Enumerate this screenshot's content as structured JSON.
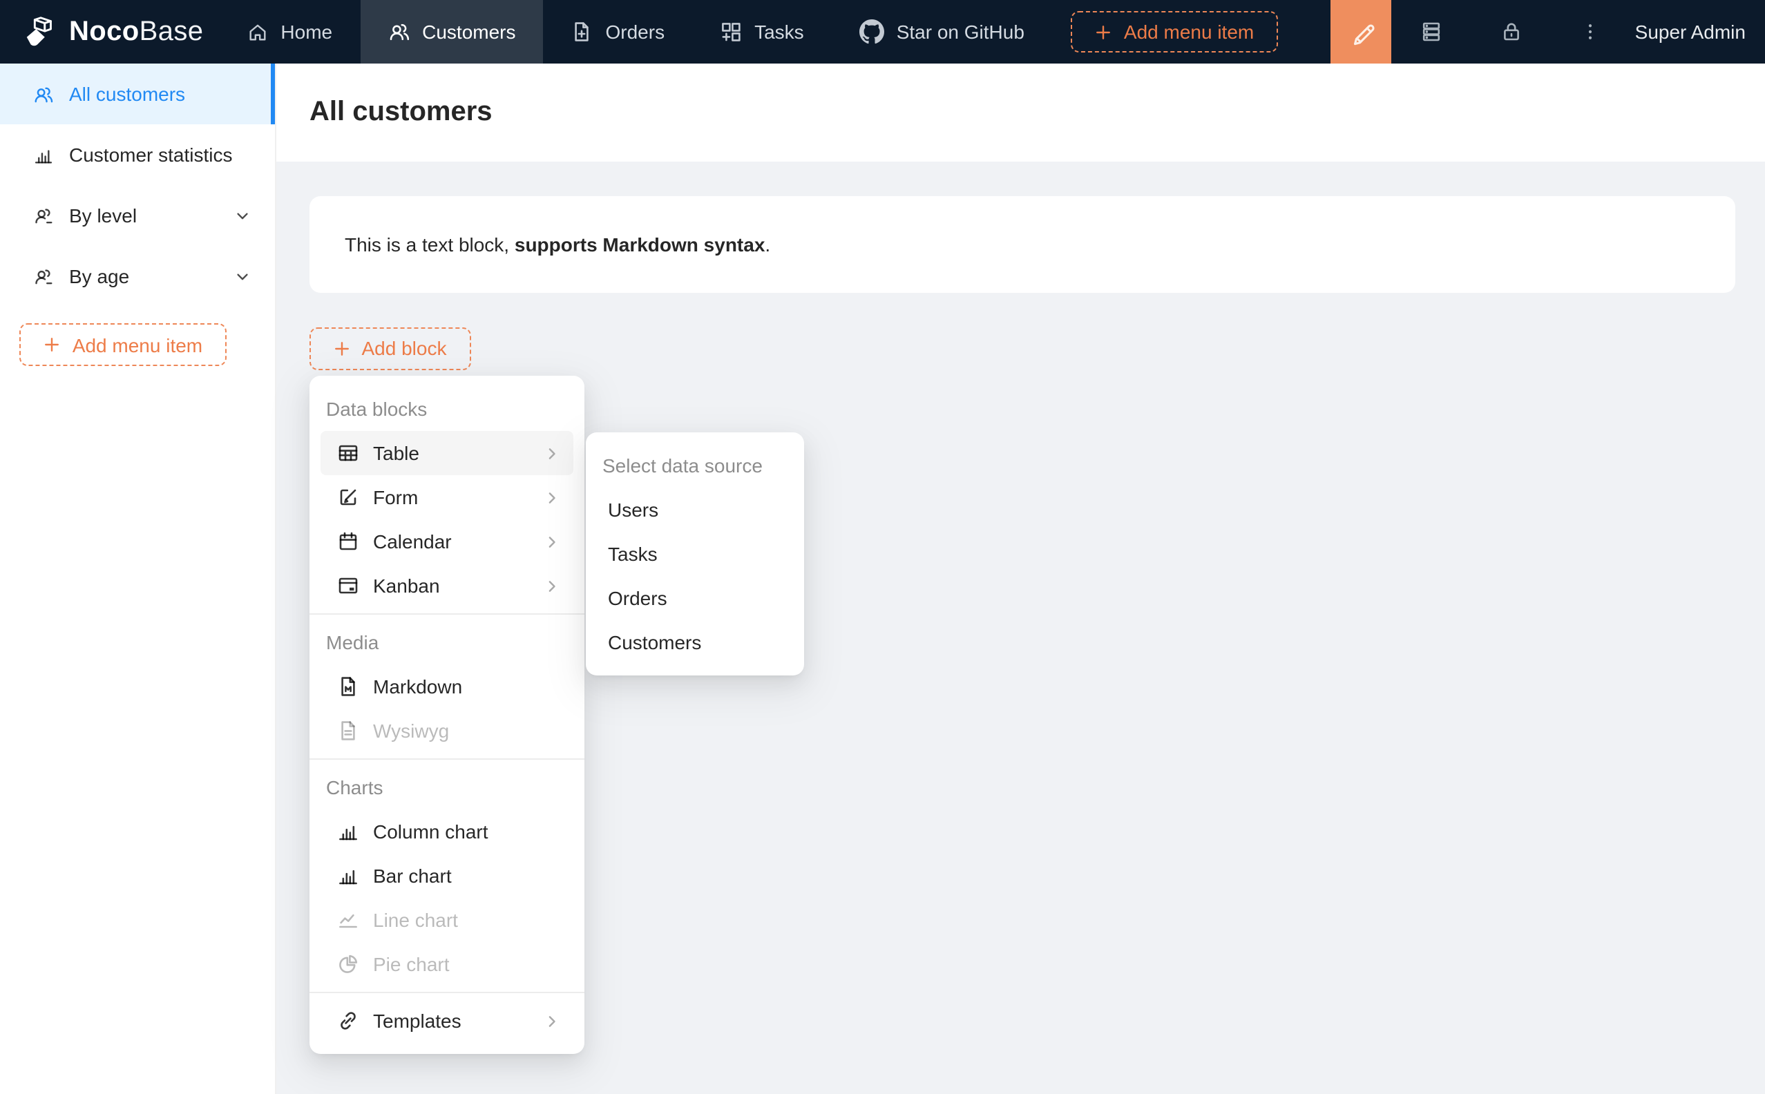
{
  "navbar": {
    "brand_bold": "Noco",
    "brand_light": "Base",
    "items": [
      {
        "label": "Home",
        "active": false
      },
      {
        "label": "Customers",
        "active": true
      },
      {
        "label": "Orders",
        "active": false
      },
      {
        "label": "Tasks",
        "active": false
      },
      {
        "label": "Star on GitHub",
        "active": false
      }
    ],
    "add_menu_item_label": "Add menu item",
    "user_label": "Super Admin"
  },
  "sidebar": {
    "items": [
      {
        "label": "All customers",
        "active": true,
        "expandable": false
      },
      {
        "label": "Customer statistics",
        "active": false,
        "expandable": false
      },
      {
        "label": "By level",
        "active": false,
        "expandable": true
      },
      {
        "label": "By age",
        "active": false,
        "expandable": true
      }
    ],
    "add_menu_item_label": "Add menu item"
  },
  "page": {
    "title": "All customers",
    "text_block": {
      "normal": "This is a text block, ",
      "bold": "supports Markdown syntax",
      "suffix": "."
    },
    "add_block_label": "Add block"
  },
  "dropdown": {
    "sections": [
      {
        "header": "Data blocks",
        "items": [
          {
            "label": "Table",
            "icon": "table-icon",
            "submenu": true,
            "hovered": true,
            "disabled": false
          },
          {
            "label": "Form",
            "icon": "form-icon",
            "submenu": true,
            "hovered": false,
            "disabled": false
          },
          {
            "label": "Calendar",
            "icon": "calendar-icon",
            "submenu": true,
            "hovered": false,
            "disabled": false
          },
          {
            "label": "Kanban",
            "icon": "kanban-icon",
            "submenu": true,
            "hovered": false,
            "disabled": false
          }
        ]
      },
      {
        "header": "Media",
        "items": [
          {
            "label": "Markdown",
            "icon": "markdown-icon",
            "submenu": false,
            "hovered": false,
            "disabled": false
          },
          {
            "label": "Wysiwyg",
            "icon": "file-icon",
            "submenu": false,
            "hovered": false,
            "disabled": true
          }
        ]
      },
      {
        "header": "Charts",
        "items": [
          {
            "label": "Column chart",
            "icon": "column-chart-icon",
            "submenu": false,
            "hovered": false,
            "disabled": false
          },
          {
            "label": "Bar chart",
            "icon": "bar-chart-icon",
            "submenu": false,
            "hovered": false,
            "disabled": false
          },
          {
            "label": "Line chart",
            "icon": "line-chart-icon",
            "submenu": false,
            "hovered": false,
            "disabled": true
          },
          {
            "label": "Pie chart",
            "icon": "pie-chart-icon",
            "submenu": false,
            "hovered": false,
            "disabled": true
          }
        ]
      }
    ],
    "templates_label": "Templates"
  },
  "submenu": {
    "header": "Select data source",
    "items": [
      {
        "label": "Users"
      },
      {
        "label": "Tasks"
      },
      {
        "label": "Orders"
      },
      {
        "label": "Customers"
      }
    ]
  },
  "colors": {
    "navbar_bg": "#0c1a2b",
    "designer_orange_bg": "#ef8e5e",
    "accent_orange": "#ed7c48",
    "dashed_orange_border": "#ee8757",
    "primary_blue": "#2189f3",
    "active_item_bg": "#e7f4fe",
    "content_bg": "#f0f2f5"
  }
}
